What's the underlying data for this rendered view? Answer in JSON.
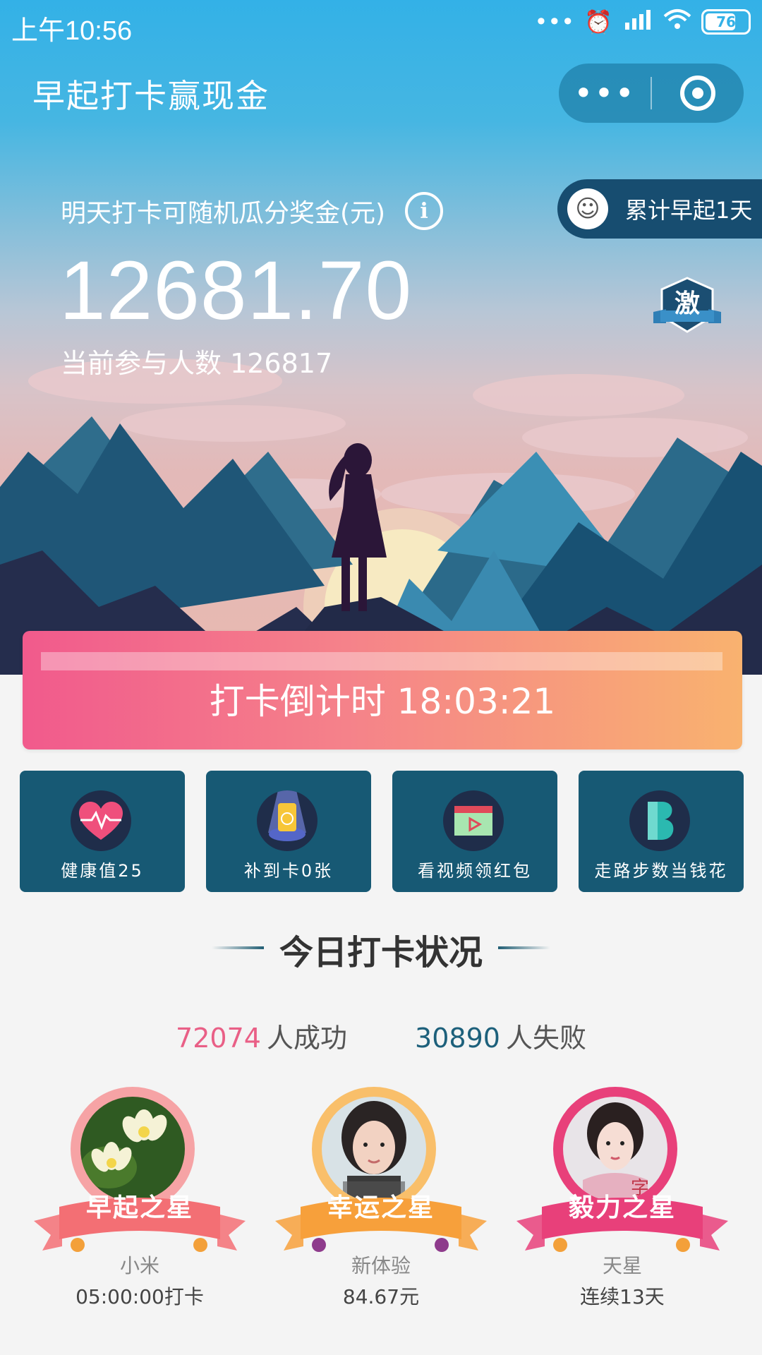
{
  "status_bar": {
    "time": "上午10:56",
    "battery": "76",
    "icons": [
      "more-dots-icon",
      "alarm-icon",
      "hd-signal-icon",
      "wifi-icon",
      "battery-icon"
    ]
  },
  "app": {
    "title": "早起打卡赢现金"
  },
  "hero": {
    "prize_label": "明天打卡可随机瓜分奖金(元)",
    "prize_amount": "12681.70",
    "participants": "当前参与人数 126817",
    "streak": "累计早起1天",
    "badge": "激"
  },
  "countdown": {
    "text": "打卡倒计时 18:03:21"
  },
  "features": [
    {
      "label": "健康值25",
      "icon": "heartbeat-icon"
    },
    {
      "label": "补到卡0张",
      "icon": "makeup-card-icon"
    },
    {
      "label": "看视频领红包",
      "icon": "video-icon"
    },
    {
      "label": "走路步数当钱花",
      "icon": "steps-b-icon"
    }
  ],
  "today": {
    "title": "今日打卡状况",
    "success_count": "72074",
    "success_word": "人成功",
    "fail_count": "30890",
    "fail_word": "人失败"
  },
  "stars": [
    {
      "ribbon": "早起之星",
      "name": "小米",
      "detail": "05:00:00打卡",
      "color": "#f36f74"
    },
    {
      "ribbon": "幸运之星",
      "name": "新体验",
      "detail": "84.67元",
      "color": "#f7a03b"
    },
    {
      "ribbon": "毅力之星",
      "name": "天星",
      "detail": "连续13天",
      "color": "#e8407a"
    }
  ],
  "colors": {
    "brand_blue": "#33b1e7",
    "card_bg": "#175974",
    "success": "#e95f86",
    "fail": "#1d607b"
  }
}
